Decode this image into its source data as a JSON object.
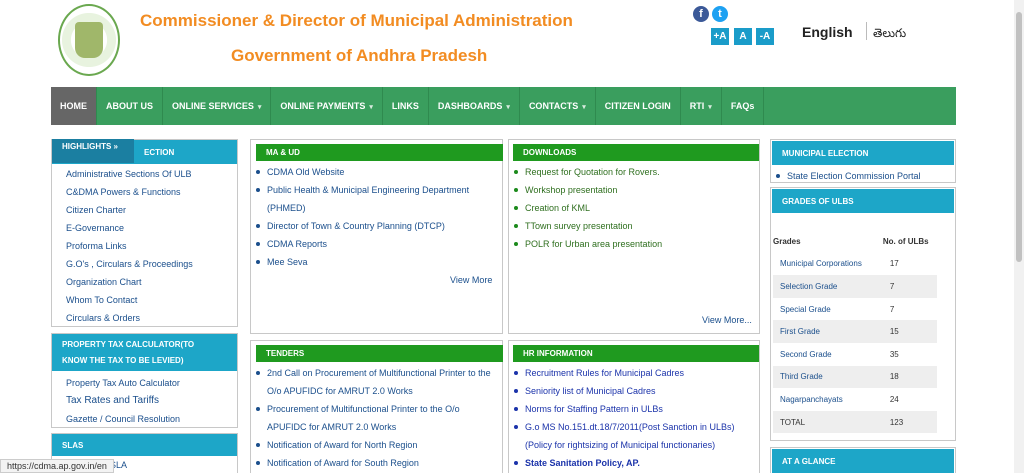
{
  "header": {
    "title_line1": "Commissioner & Director of Municipal Administration",
    "title_line2": "Government of Andhra Pradesh",
    "social": {
      "facebook": "f",
      "twitter": "t"
    },
    "font_controls": [
      "+A",
      "A",
      "-A"
    ],
    "lang_english": "English",
    "lang_telugu": "తెలుగు"
  },
  "nav": [
    {
      "label": "HOME",
      "caret": false
    },
    {
      "label": "ABOUT US",
      "caret": false
    },
    {
      "label": "ONLINE SERVICES",
      "caret": true
    },
    {
      "label": "ONLINE PAYMENTS",
      "caret": true
    },
    {
      "label": "LINKS",
      "caret": false
    },
    {
      "label": "DASHBOARDS",
      "caret": true
    },
    {
      "label": "CONTACTS",
      "caret": true
    },
    {
      "label": "CITIZEN LOGIN",
      "caret": false
    },
    {
      "label": "RTI",
      "caret": true
    },
    {
      "label": "FAQs",
      "caret": false
    }
  ],
  "highlights": {
    "tab": "HIGHLIGHTS »",
    "tab_suffix": "ECTION",
    "items": [
      "Administrative Sections Of ULB",
      "C&DMA Powers & Functions",
      "Citizen Charter",
      "E-Governance",
      "Proforma Links",
      "G.O's , Circulars & Proceedings",
      "Organization Chart",
      "Whom To Contact",
      "Circulars & Orders"
    ]
  },
  "property_tax": {
    "title_line1": "PROPERTY TAX CALCULATOR(TO",
    "title_line2": "KNOW THE TAX TO BE LEVIED)",
    "items": [
      "Property Tax Auto Calculator",
      "Tax Rates and Tariffs",
      "Gazette / Council Resolution"
    ]
  },
  "slas": {
    "title": "SLAS",
    "item": "SLA"
  },
  "ma_ud": {
    "title": "MA & UD",
    "items": [
      "CDMA Old Website",
      "Public Health & Municipal Engineering Department (PHMED)",
      "Director of Town & Country Planning (DTCP)",
      "CDMA Reports",
      "Mee Seva"
    ],
    "view_more": "View More"
  },
  "downloads": {
    "title": "DOWNLOADS",
    "items": [
      "Request for Quotation for Rovers.",
      "Workshop presentation",
      "Creation of KML",
      "TTown survey presentation",
      "POLR for Urban area presentation"
    ],
    "view_more": "View More..."
  },
  "tenders": {
    "title": "TENDERS",
    "items": [
      "2nd Call on Procurement of Multifunctional Printer to the O/o APUFIDC for AMRUT 2.0 Works",
      "Procurement of Multifunctional Printer to the O/o APUFIDC for AMRUT 2.0 Works",
      "Notification of Award for North Region",
      "Notification of Award for South Region"
    ]
  },
  "hr": {
    "title": "HR INFORMATION",
    "items": [
      "Recruitment Rules for Municipal Cadres",
      "Seniority list of Municipal Cadres",
      "Norms for Staffing Pattern in ULBs",
      "G.o MS No.151.dt.18/7/2011(Post Sanction in ULBs) (Policy for rightsizing of Municipal functionaries)",
      "State Sanitation Policy, AP."
    ]
  },
  "municipal_election": {
    "title": "MUNICIPAL ELECTION",
    "item": "State Election Commission Portal"
  },
  "grades": {
    "title": "GRADES OF ULBS",
    "col_grade": "Grades",
    "col_count": "No. of ULBs",
    "rows": [
      {
        "grade": "Municipal Corporations",
        "count": "17"
      },
      {
        "grade": "Selection Grade",
        "count": "7"
      },
      {
        "grade": "Special Grade",
        "count": "7"
      },
      {
        "grade": "First Grade",
        "count": "15"
      },
      {
        "grade": "Second Grade",
        "count": "35"
      },
      {
        "grade": "Third Grade",
        "count": "18"
      },
      {
        "grade": "Nagarpanchayats",
        "count": "24"
      },
      {
        "grade": "TOTAL",
        "count": "123"
      }
    ]
  },
  "at_a_glance": {
    "title": "AT A GLANCE"
  },
  "status_url": "https://cdma.ap.gov.in/en"
}
